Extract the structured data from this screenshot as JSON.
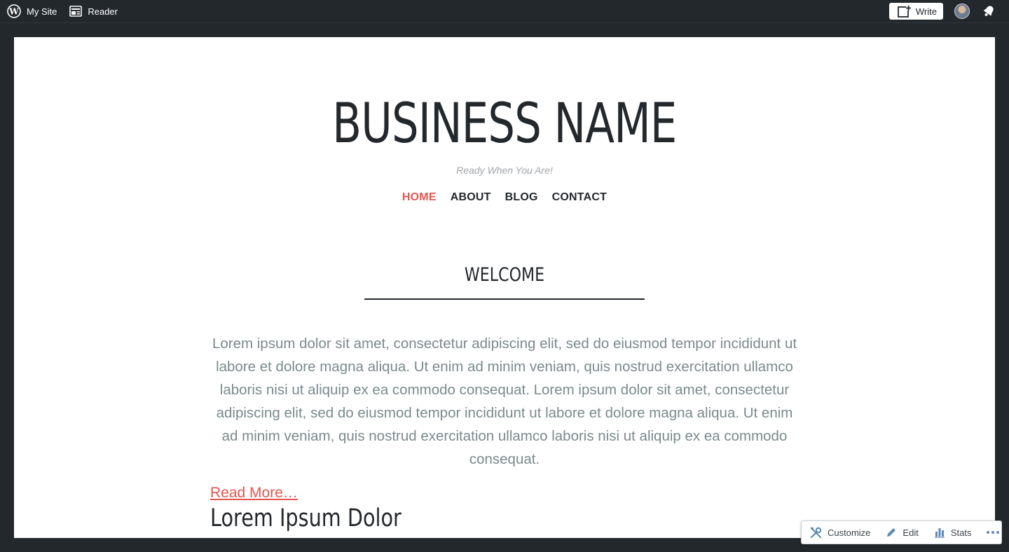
{
  "adminbar": {
    "my_site_label": "My Site",
    "reader_label": "Reader",
    "write_label": "Write"
  },
  "site": {
    "title": "BUSINESS NAME",
    "tagline": "Ready When You Are!",
    "nav": [
      {
        "label": "HOME",
        "active": true
      },
      {
        "label": "ABOUT",
        "active": false
      },
      {
        "label": "BLOG",
        "active": false
      },
      {
        "label": "CONTACT",
        "active": false
      }
    ]
  },
  "content": {
    "welcome_heading": "WELCOME",
    "paragraph": "Lorem ipsum dolor sit amet, consectetur adipiscing elit, sed do eiusmod tempor incididunt ut labore et dolore magna aliqua. Ut enim ad minim veniam, quis nostrud exercitation ullamco laboris nisi ut aliquip ex ea commodo consequat. Lorem ipsum dolor sit amet, consectetur adipiscing elit, sed do eiusmod tempor incididunt ut labore et dolore magna aliqua. Ut enim ad minim veniam, quis nostrud exercitation ullamco laboris nisi ut aliquip ex ea commodo consequat.",
    "read_more": "Read More…",
    "section_heading": "Lorem Ipsum Dolor"
  },
  "toolbar": {
    "customize_label": "Customize",
    "edit_label": "Edit",
    "stats_label": "Stats"
  },
  "colors": {
    "accent": "#e5554e",
    "admin_bar": "#23282d",
    "body_text": "#7a8a8c"
  },
  "icons": {
    "logo": "wordpress-logo-icon",
    "reader": "reader-icon",
    "write": "write-icon",
    "notifications": "notifications-bell-icon",
    "customize": "customize-tools-icon",
    "edit": "pencil-icon",
    "stats": "stats-bars-icon",
    "more": "more-dots-icon"
  }
}
